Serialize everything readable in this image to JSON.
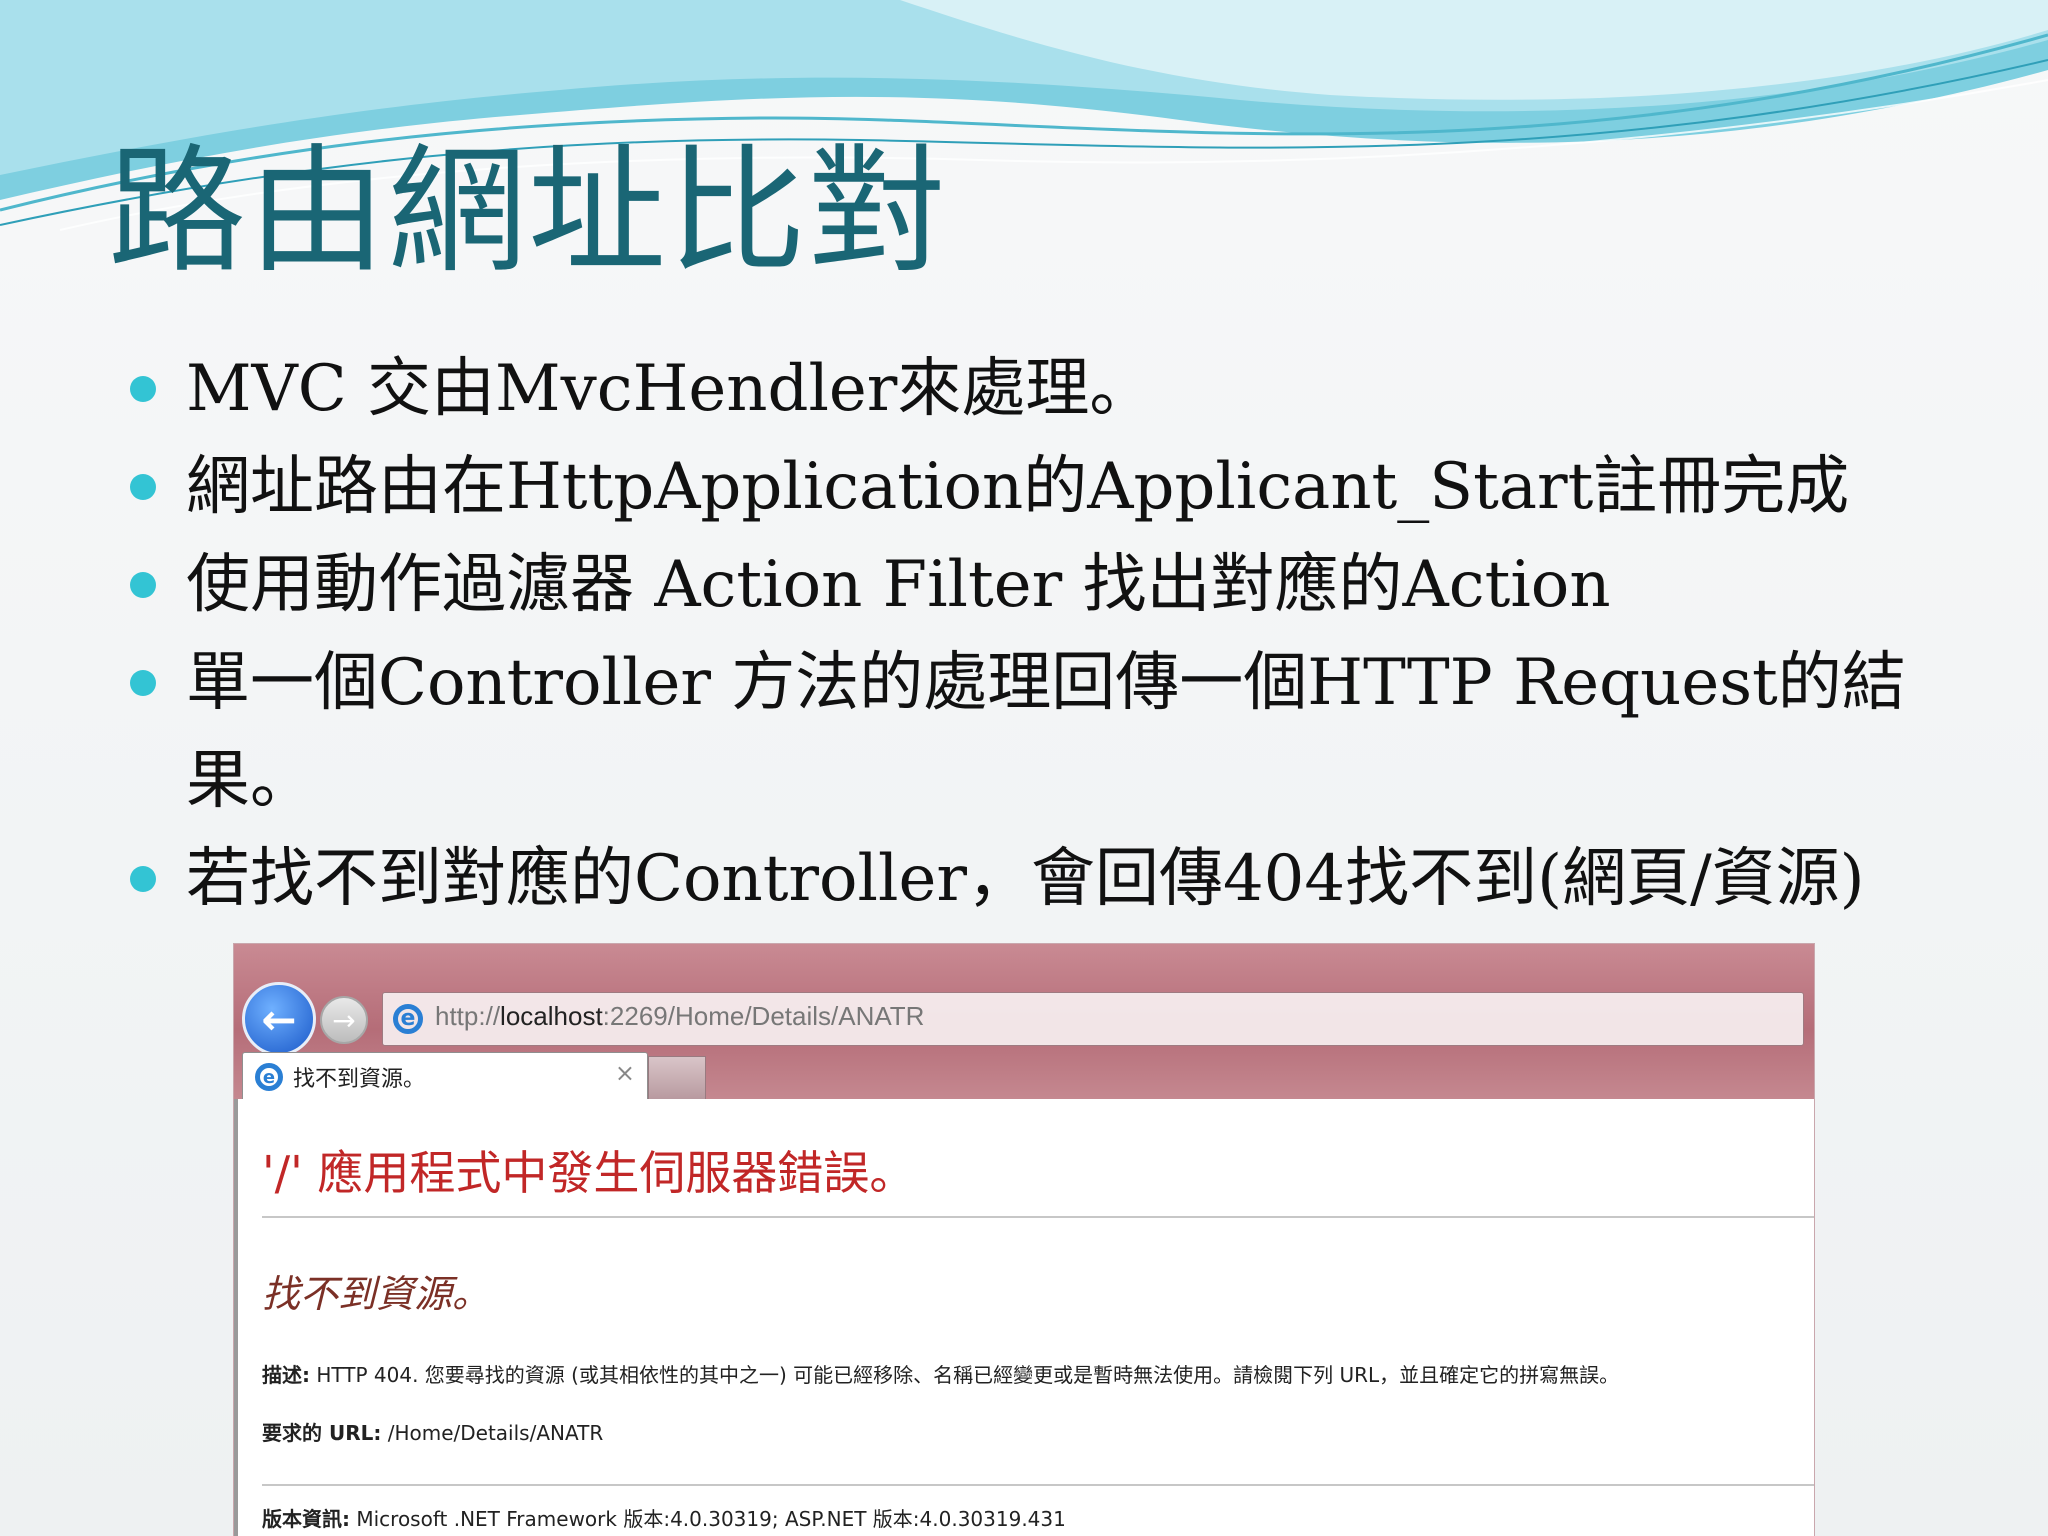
{
  "slide": {
    "title": "路由網址比對",
    "bullets": [
      "MVC 交由MvcHendler來處理。",
      "網址路由在HttpApplication的Applicant_Start註冊完成",
      "使用動作過濾器 Action Filter 找出對應的Action",
      "單一個Controller 方法的處理回傳一個HTTP Request的結果。",
      "若找不到對應的Controller，會回傳404找不到(網頁/資源)"
    ]
  },
  "browser": {
    "address_prefix": "http://",
    "address_host": "localhost",
    "address_rest": ":2269/Home/Details/ANATR",
    "tab_title": "找不到資源。",
    "tab_close": "×"
  },
  "error_page": {
    "heading": "'/' 應用程式中發生伺服器錯誤。",
    "subheading": "找不到資源。",
    "description_label": "描述:",
    "description_text": " HTTP 404. 您要尋找的資源 (或其相依性的其中之一) 可能已經移除、名稱已經變更或是暫時無法使用。請檢閱下列 URL，並且確定它的拼寫無誤。",
    "url_label": "要求的 URL:",
    "url_value": " /Home/Details/ANATR",
    "version_label": "版本資訊:",
    "version_value": " Microsoft .NET Framework 版本:4.0.30319; ASP.NET 版本:4.0.30319.431"
  },
  "icons": {
    "back": "back-arrow-icon",
    "forward": "forward-arrow-icon",
    "ie": "internet-explorer-icon",
    "bullet": "bullet-dot-icon"
  },
  "colors": {
    "title": "#1a6675",
    "bullet": "#33c4d4",
    "error_heading": "#c12727",
    "chrome": "#b56d78"
  }
}
